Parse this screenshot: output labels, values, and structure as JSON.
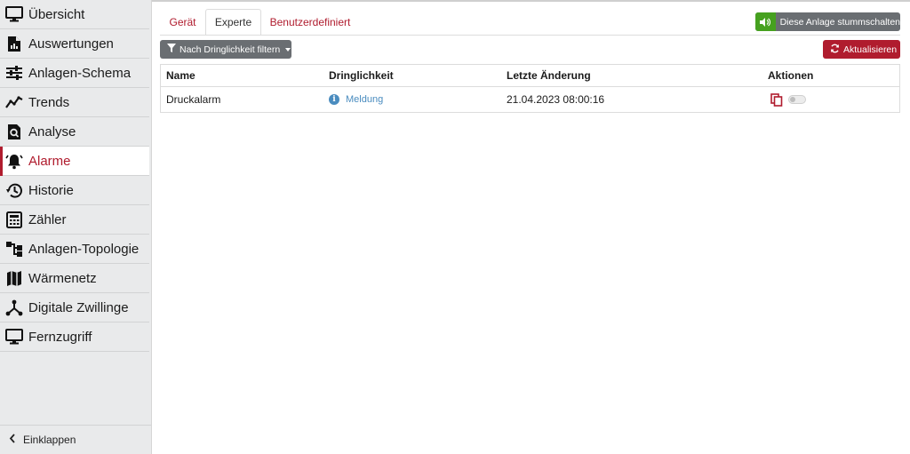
{
  "sidebar": {
    "items": [
      {
        "label": "Übersicht",
        "icon": "monitor-icon"
      },
      {
        "label": "Auswertungen",
        "icon": "document-chart-icon"
      },
      {
        "label": "Anlagen-Schema",
        "icon": "sliders-icon"
      },
      {
        "label": "Trends",
        "icon": "trend-line-icon"
      },
      {
        "label": "Analyse",
        "icon": "magnifier-document-icon"
      },
      {
        "label": "Alarme",
        "icon": "bell-ringing-icon"
      },
      {
        "label": "Historie",
        "icon": "history-icon"
      },
      {
        "label": "Zähler",
        "icon": "calculator-icon"
      },
      {
        "label": "Anlagen-Topologie",
        "icon": "topology-icon"
      },
      {
        "label": "Wärmenetz",
        "icon": "map-icon"
      },
      {
        "label": "Digitale Zwillinge",
        "icon": "network-branch-icon"
      },
      {
        "label": "Fernzugriff",
        "icon": "monitor-icon"
      }
    ],
    "active_index": 5,
    "collapse_label": "Einklappen"
  },
  "tabs": [
    {
      "label": "Gerät"
    },
    {
      "label": "Experte"
    },
    {
      "label": "Benutzerdefiniert"
    }
  ],
  "active_tab": "Experte",
  "toolbar": {
    "mute_label": "Diese Anlage stummschalten",
    "refresh_label": "Aktualisieren",
    "filter_label": "Nach Dringlichkeit filtern"
  },
  "table": {
    "columns": [
      "Name",
      "Dringlichkeit",
      "Letzte Änderung",
      "Aktionen"
    ],
    "rows": [
      {
        "name": "Druckalarm",
        "severity": "Meldung",
        "changed": "21.04.2023 08:00:16"
      }
    ]
  },
  "colors": {
    "accent": "#b01c2e",
    "mute_green": "#46a11f",
    "button_gray": "#6a6e72",
    "info_blue": "#4a8cbf"
  }
}
